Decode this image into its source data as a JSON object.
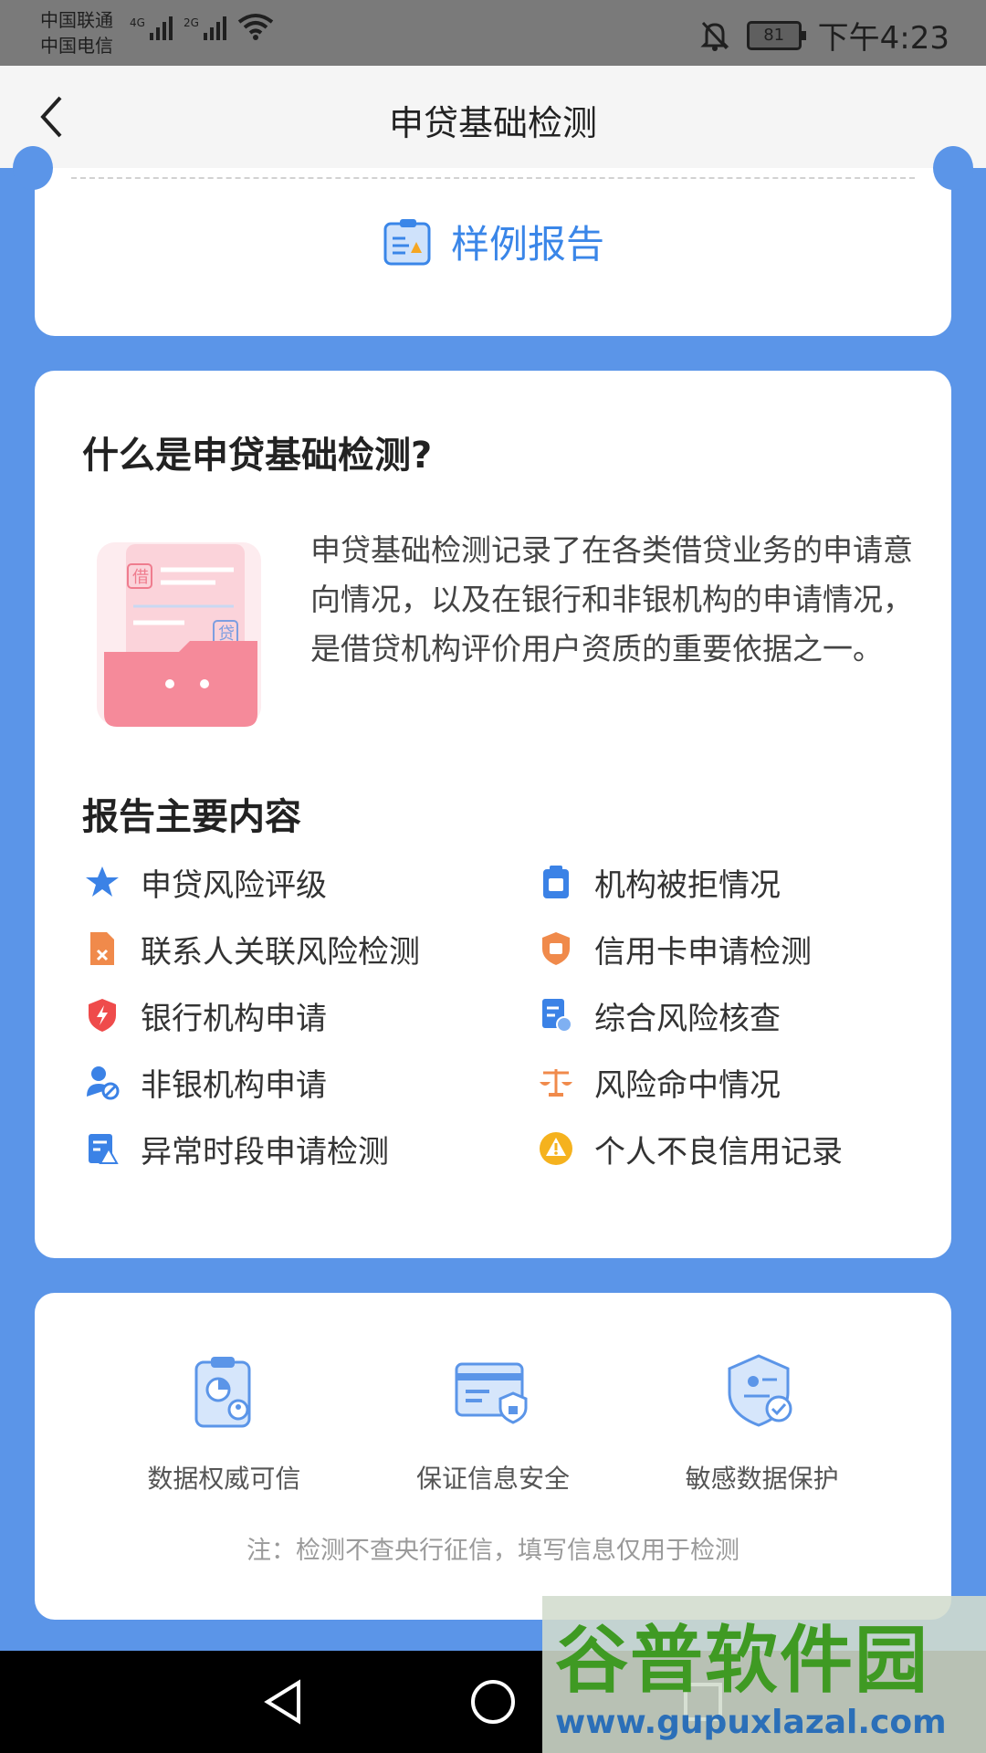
{
  "status_bar": {
    "carrier_1": "中国联通",
    "carrier_2": "中国电信",
    "network_1": "4G",
    "network_2": "2G",
    "battery": "81",
    "time": "下午4:23"
  },
  "nav": {
    "title": "申贷基础检测"
  },
  "sample": {
    "label": "样例报告"
  },
  "intro": {
    "heading": "什么是申贷基础检测?",
    "description": "申贷基础检测记录了在各类借贷业务的申请意向情况，以及在银行和非银机构的申请情况，是借贷机构评价用户资质的重要依据之一。",
    "illustration_tags": [
      "借",
      "贷"
    ]
  },
  "report": {
    "heading": "报告主要内容",
    "items": [
      {
        "label": "申贷风险评级",
        "icon": "star-icon",
        "color": "#3b82e6"
      },
      {
        "label": "机构被拒情况",
        "icon": "loan-doc-icon",
        "color": "#3b82e6"
      },
      {
        "label": "联系人关联风险检测",
        "icon": "doc-cross-icon",
        "color": "#f08a4b"
      },
      {
        "label": "信用卡申请检测",
        "icon": "shield-badge-icon",
        "color": "#f08a4b"
      },
      {
        "label": "银行机构申请",
        "icon": "bolt-shield-icon",
        "color": "#ef4b4b"
      },
      {
        "label": "综合风险核查",
        "icon": "doc-check-icon",
        "color": "#3b82e6"
      },
      {
        "label": "非银机构申请",
        "icon": "user-block-icon",
        "color": "#3b82e6"
      },
      {
        "label": "风险命中情况",
        "icon": "scale-icon",
        "color": "#f08a4b"
      },
      {
        "label": "异常时段申请检测",
        "icon": "doc-warning-icon",
        "color": "#3b82e6"
      },
      {
        "label": "个人不良信用记录",
        "icon": "warning-icon",
        "color": "#f5b21e"
      }
    ]
  },
  "trust": {
    "items": [
      {
        "label": "数据权威可信",
        "icon": "clipboard-chart-icon"
      },
      {
        "label": "保证信息安全",
        "icon": "card-lock-icon"
      },
      {
        "label": "敏感数据保护",
        "icon": "shield-check-icon"
      }
    ],
    "note": "注：检测不查央行征信，填写信息仅用于检测"
  },
  "watermark": {
    "text": "谷普软件园",
    "url": "www.gupuxlazal.com"
  }
}
